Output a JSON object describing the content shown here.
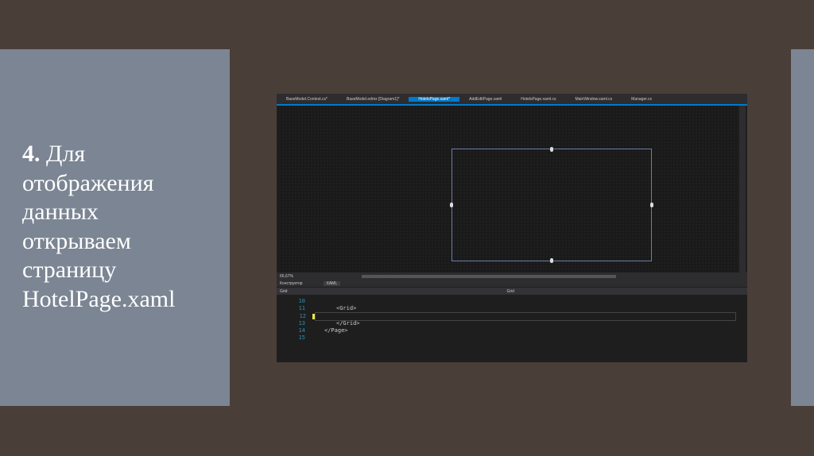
{
  "slide": {
    "number": "4.",
    "text_lines": [
      "Для",
      "отображения",
      "данных",
      "открываем",
      "страницу",
      "HotelPage.xaml"
    ]
  },
  "ide": {
    "tabs": [
      "BaseModel.Context.cs*",
      "BaseModel.edmx [Diagram1]*",
      "HotelsPage.xaml*",
      "AddEditPage.xaml",
      "HotelsPage.xaml.cs",
      "MainWindow.xaml.cs",
      "Manager.cs"
    ],
    "zoom": "66,67%",
    "designer_tab": "Конструктор",
    "xaml_tab": "XAML",
    "breadcrumb_left": "Grid",
    "breadcrumb_right": "Grid",
    "code": [
      {
        "n": "10",
        "t": ""
      },
      {
        "n": "11",
        "t": "<Grid>"
      },
      {
        "n": "12",
        "t": ""
      },
      {
        "n": "13",
        "t": "</Grid>"
      },
      {
        "n": "14",
        "t": "</Page>"
      },
      {
        "n": "15",
        "t": ""
      }
    ]
  }
}
